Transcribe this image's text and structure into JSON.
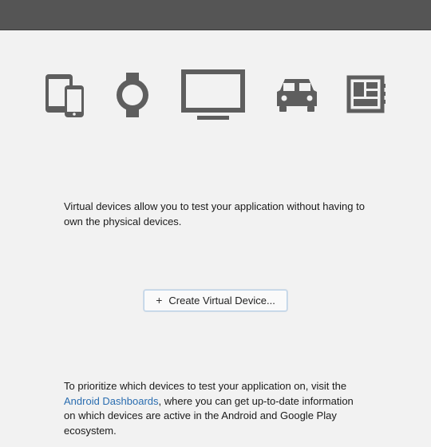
{
  "icons": {
    "phoneTablet": "phone-tablet-icon",
    "watch": "watch-icon",
    "tv": "tv-icon",
    "car": "car-icon",
    "things": "things-icon"
  },
  "description": "Virtual devices allow you to test your application without having to own the physical devices.",
  "button": {
    "label": "Create Virtual Device..."
  },
  "footer": {
    "pre": "To prioritize which devices to test your application on, visit the ",
    "linkText": "Android Dashboards",
    "post": ", where you can get up-to-date information on which devices are active in the Android and Google Play ecosystem."
  }
}
